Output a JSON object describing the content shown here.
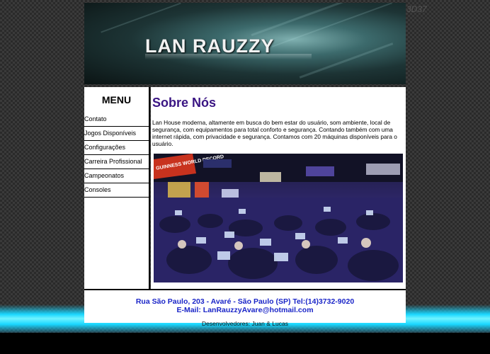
{
  "banner": {
    "title": "LAN RAUZZY",
    "corner_mark": "3D37"
  },
  "menu": {
    "title": "MENU",
    "items": [
      {
        "label": "Contato"
      },
      {
        "label": "Jogos Disponíveis"
      },
      {
        "label": "Configurações"
      },
      {
        "label": "Carreira Profissional"
      },
      {
        "label": "Campeonatos"
      },
      {
        "label": "Consoles"
      }
    ]
  },
  "content": {
    "heading": "Sobre Nós",
    "paragraph": "Lan House moderna, altamente em busca do bem estar do usuário, som ambiente, local de segurança, com equipamentos para total conforto e segurança. Contando também com uma internet rápida, com privacidade e segurança. Contamos com 20 máquinas disponíveis para o usuário.",
    "photo_sign": "GUINNESS WORLD RECORD"
  },
  "footer": {
    "address": "Rua São Paulo, 203 - Avaré - São Paulo (SP) Tel:(14)3732-9020",
    "email": "E-Mail: LanRauzzyAvare@hotmail.com"
  },
  "developers": "Desenvolvedores: Juan & Lucas",
  "colors": {
    "heading": "#3a1583",
    "footer_text": "#1a25c8",
    "glow": "#1ad7ff"
  }
}
